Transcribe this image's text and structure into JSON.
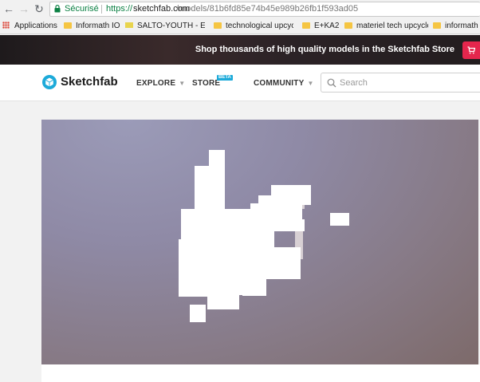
{
  "browser": {
    "secure_label": "Sécurisé",
    "url_scheme": "https://",
    "url_host": "sketchfab.com",
    "url_path": "/models/81b6fd85e74b45e989b26fb1f593ad05",
    "bookmarks": [
      "Applications",
      "Informath IO",
      "SALTO-YOUTH - Euro",
      "technological upcycl",
      "E+KA2",
      "materiel tech upcycle",
      "informath ("
    ]
  },
  "promo": {
    "text": "Shop thousands of high quality models in the Sketchfab Store"
  },
  "header": {
    "logo": "Sketchfab",
    "menu": [
      "EXPLORE",
      "STORE",
      "COMMUNITY"
    ],
    "beta": "BETA",
    "search_placeholder": "Search"
  },
  "colors": {
    "accent": "#1caad9",
    "promo_button": "#e5264d",
    "secure_green": "#0b8043"
  }
}
